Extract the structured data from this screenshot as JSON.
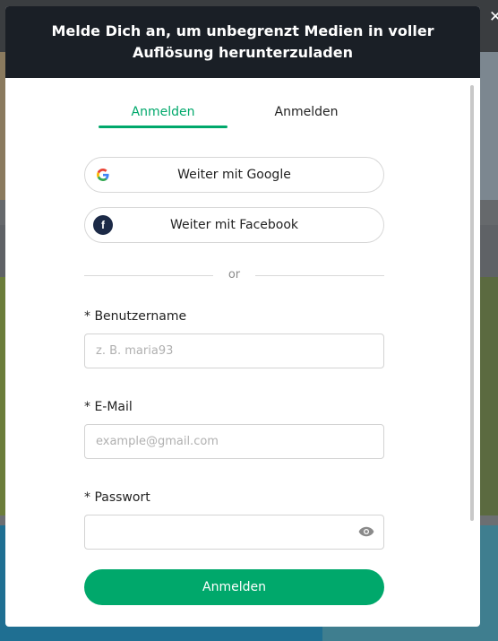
{
  "modal": {
    "title": "Melde Dich an, um unbegrenzt Medien in voller Auflösung herunterzuladen",
    "close_icon": "close-icon"
  },
  "tabs": [
    {
      "label": "Anmelden",
      "active": true
    },
    {
      "label": "Anmelden",
      "active": false
    }
  ],
  "social": {
    "google_label": "Weiter mit Google",
    "google_icon": "google-icon",
    "facebook_label": "Weiter mit Facebook",
    "facebook_icon": "facebook-icon"
  },
  "divider_text": "or",
  "form": {
    "username": {
      "label": "* Benutzername",
      "placeholder": "z. B. maria93",
      "value": ""
    },
    "email": {
      "label": "* E-Mail",
      "placeholder": "example@gmail.com",
      "value": ""
    },
    "password": {
      "label": "* Passwort",
      "placeholder": "",
      "value": "",
      "toggle_icon": "eye-icon"
    },
    "submit_label": "Anmelden"
  },
  "colors": {
    "accent": "#00a86b",
    "header_bg": "#1a1f26",
    "facebook": "#1c2a47"
  }
}
